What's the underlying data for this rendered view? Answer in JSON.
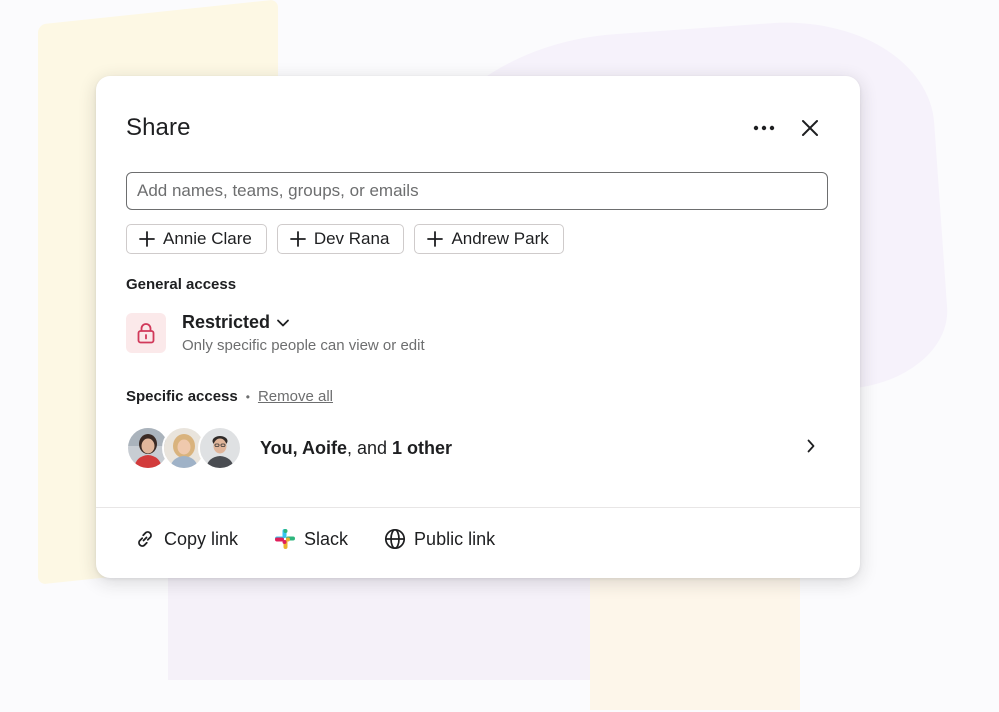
{
  "dialog": {
    "title": "Share",
    "more_icon": "more-horizontal-icon",
    "close_icon": "close-icon"
  },
  "search": {
    "placeholder": "Add names, teams, groups, or emails",
    "value": ""
  },
  "suggestions": [
    {
      "label": "Annie Clare",
      "icon": "plus-icon"
    },
    {
      "label": "Dev Rana",
      "icon": "plus-icon"
    },
    {
      "label": "Andrew Park",
      "icon": "plus-icon"
    }
  ],
  "general_access": {
    "heading": "General access",
    "level": "Restricted",
    "description": "Only specific people can view or edit",
    "icon": "lock-icon",
    "colors": {
      "tile_bg": "#fbe9ea",
      "icon": "#d1395a"
    }
  },
  "specific_access": {
    "heading": "Specific access",
    "separator": "•",
    "remove_all": "Remove all",
    "people_prefix": "You, Aoife",
    "people_mid": ", and ",
    "people_count": "1 other"
  },
  "footer": {
    "copy_link": "Copy link",
    "slack": "Slack",
    "public_link": "Public link"
  }
}
